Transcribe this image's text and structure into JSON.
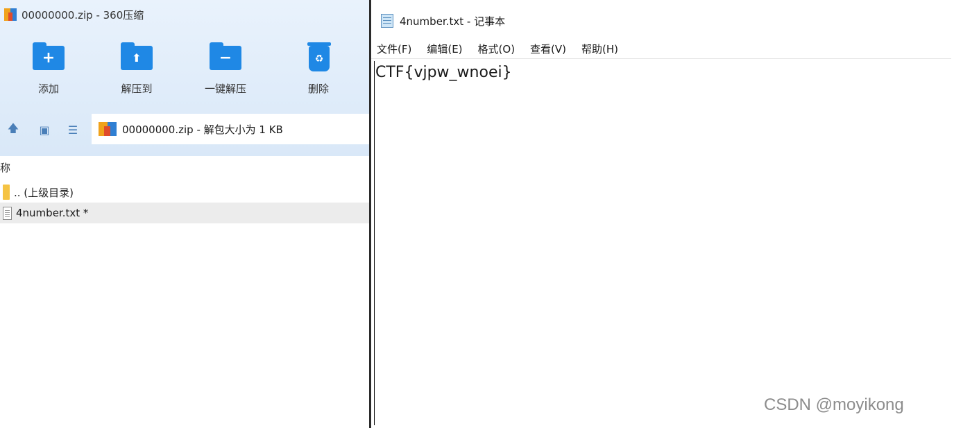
{
  "zip_window": {
    "title": "00000000.zip - 360压缩",
    "toolbar": [
      {
        "label": "添加",
        "icon": "folder-plus-icon",
        "glyph": "+"
      },
      {
        "label": "解压到",
        "icon": "folder-extract-icon",
        "glyph": "⬆"
      },
      {
        "label": "一键解压",
        "icon": "folder-oneclick-icon",
        "glyph": "−"
      },
      {
        "label": "删除",
        "icon": "trash-icon",
        "glyph": "♻"
      }
    ],
    "nav_icons": [
      "up-arrow-icon",
      "thumbnail-view-icon",
      "list-view-icon"
    ],
    "path": "00000000.zip - 解包大小为 1 KB",
    "column_header": "称",
    "files": [
      {
        "name": ".. (上级目录)",
        "icon": "folder-icon",
        "selected": false
      },
      {
        "name": "4number.txt *",
        "icon": "text-file-icon",
        "selected": true
      }
    ]
  },
  "notepad": {
    "title": "4number.txt - 记事本",
    "menu": [
      "文件(F)",
      "编辑(E)",
      "格式(O)",
      "查看(V)",
      "帮助(H)"
    ],
    "content": "CTF{vjpw_wnoei}"
  },
  "watermark": "CSDN @moyikong",
  "colors": {
    "accent_blue": "#1f88e5",
    "header_bg": "#d9e8f8",
    "selected_row": "#ececec"
  }
}
